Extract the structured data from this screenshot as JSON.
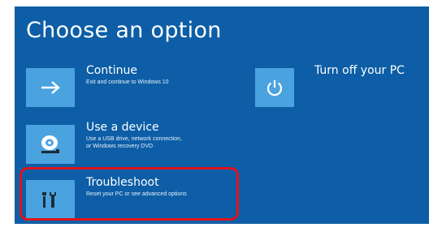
{
  "page": {
    "title": "Choose an option"
  },
  "options": {
    "continue": {
      "title": "Continue",
      "description": "Exit and continue to Windows 10",
      "icon": "arrow-right-icon"
    },
    "use_device": {
      "title": "Use a device",
      "description": "Use a USB drive, network connection,\nor Windows recovery DVD",
      "icon": "disc-drive-icon"
    },
    "troubleshoot": {
      "title": "Troubleshoot",
      "description": "Reset your PC or see advanced options",
      "icon": "tools-icon"
    },
    "turn_off": {
      "title": "Turn off your PC",
      "icon": "power-icon"
    }
  },
  "colors": {
    "background": "#0d5ea6",
    "tile": "#4aa3df",
    "text": "#ffffff",
    "highlight": "#e0131b"
  }
}
